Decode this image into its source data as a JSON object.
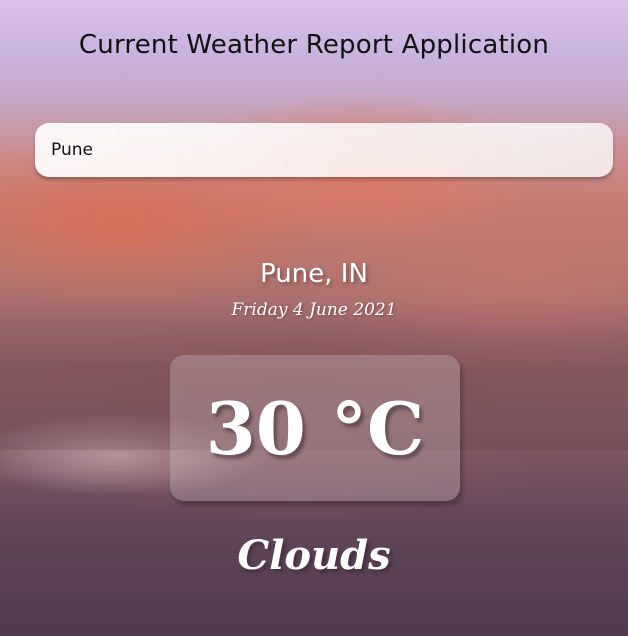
{
  "app": {
    "title": "Current Weather Report Application"
  },
  "search": {
    "value": "Pune",
    "placeholder": ""
  },
  "weather": {
    "location": "Pune, IN",
    "date": "Friday 4 June 2021",
    "temperature": "30 °C",
    "condition": "Clouds"
  }
}
